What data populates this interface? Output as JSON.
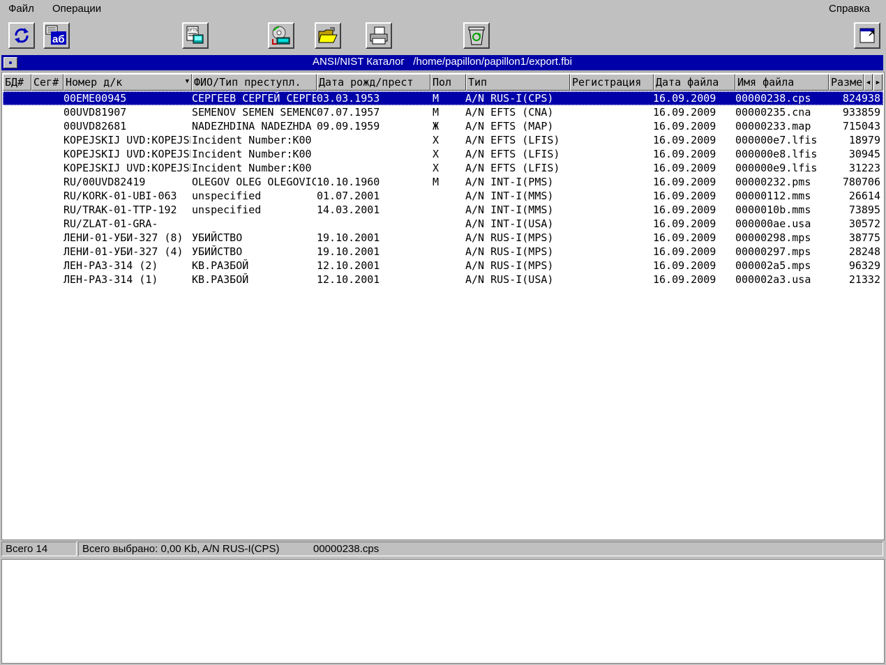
{
  "menu": {
    "file": "Файл",
    "operations": "Операции",
    "help": "Справка"
  },
  "toolbar": {
    "buttons": [
      "refresh-icon",
      "font-icon",
      "efts-icon",
      "cd-icon",
      "open-folder-icon",
      "print-icon",
      "recycle-icon",
      "exit-icon"
    ]
  },
  "window": {
    "title": "ANSI/NIST Каталог   /home/papillon/papillon1/export.fbi"
  },
  "columns": [
    "БД#",
    "Сег#",
    "Номер д/к",
    "ФИО/Тип преступл.",
    "Дата рожд/прест",
    "Пол",
    "Тип",
    "Регистрация",
    "Дата файла",
    "Имя файла",
    "Размер"
  ],
  "rows": [
    {
      "num": "00EME00945",
      "fio": "СЕРГЕЕВ СЕРГЕЙ СЕРГЕЕВИЧ",
      "date": "03.03.1953",
      "sex": "М",
      "type": "A/N RUS-I(CPS)",
      "reg": "",
      "fdate": "16.09.2009",
      "fname": "00000238.cps",
      "size": "824938"
    },
    {
      "num": "00UVD81907",
      "fio": "SEMENOV SEMEN SEMENOVICH",
      "date": "07.07.1957",
      "sex": "М",
      "type": "A/N EFTS (CNA)",
      "reg": "",
      "fdate": "16.09.2009",
      "fname": "00000235.cna",
      "size": "933859"
    },
    {
      "num": "00UVD82681",
      "fio": "NADEZHDINA NADEZHDA",
      "date": "09.09.1959",
      "sex": "Ж",
      "type": "A/N EFTS (MAP)",
      "reg": "",
      "fdate": "16.09.2009",
      "fname": "00000233.map",
      "size": "715043"
    },
    {
      "num": "KOPEJSKIJ UVD:KOPEJSK",
      "fio": "Incident Number:K00",
      "date": "",
      "sex": "X",
      "type": "A/N EFTS (LFIS)",
      "reg": "",
      "fdate": "16.09.2009",
      "fname": "000000e7.lfis",
      "size": "18979"
    },
    {
      "num": "KOPEJSKIJ UVD:KOPEJSK",
      "fio": "Incident Number:K00",
      "date": "",
      "sex": "X",
      "type": "A/N EFTS (LFIS)",
      "reg": "",
      "fdate": "16.09.2009",
      "fname": "000000e8.lfis",
      "size": "30945"
    },
    {
      "num": "KOPEJSKIJ UVD:KOPEJSK",
      "fio": "Incident Number:K00",
      "date": "",
      "sex": "X",
      "type": "A/N EFTS (LFIS)",
      "reg": "",
      "fdate": "16.09.2009",
      "fname": "000000e9.lfis",
      "size": "31223"
    },
    {
      "num": "RU/00UVD82419",
      "fio": "OLEGOV OLEG OLEGOVICH",
      "date": "10.10.1960",
      "sex": "М",
      "type": "A/N INT-I(PMS)",
      "reg": "",
      "fdate": "16.09.2009",
      "fname": "00000232.pms",
      "size": "780706"
    },
    {
      "num": "RU/KORK-01-UBI-063",
      "fio": "unspecified",
      "date": "01.07.2001",
      "sex": "",
      "type": "A/N INT-I(MMS)",
      "reg": "",
      "fdate": "16.09.2009",
      "fname": "00000112.mms",
      "size": "26614"
    },
    {
      "num": "RU/TRAK-01-TTP-192",
      "fio": "unspecified",
      "date": "14.03.2001",
      "sex": "",
      "type": "A/N INT-I(MMS)",
      "reg": "",
      "fdate": "16.09.2009",
      "fname": "0000010b.mms",
      "size": "73895"
    },
    {
      "num": "RU/ZLAT-01-GRA-",
      "fio": "",
      "date": "",
      "sex": "",
      "type": "A/N INT-I(USA)",
      "reg": "",
      "fdate": "16.09.2009",
      "fname": "000000ae.usa",
      "size": "30572"
    },
    {
      "num": "ЛЕНИ-01-УБИ-327 (8)",
      "fio": "УБИЙСТВО",
      "date": "19.10.2001",
      "sex": "",
      "type": "A/N RUS-I(MPS)",
      "reg": "",
      "fdate": "16.09.2009",
      "fname": "00000298.mps",
      "size": "38775"
    },
    {
      "num": "ЛЕНИ-01-УБИ-327 (4)",
      "fio": "УБИЙСТВО",
      "date": "19.10.2001",
      "sex": "",
      "type": "A/N RUS-I(MPS)",
      "reg": "",
      "fdate": "16.09.2009",
      "fname": "00000297.mps",
      "size": "28248"
    },
    {
      "num": "ЛЕН-РАЗ-314 (2)",
      "fio": "КВ.РАЗБОЙ",
      "date": "12.10.2001",
      "sex": "",
      "type": "A/N RUS-I(MPS)",
      "reg": "",
      "fdate": "16.09.2009",
      "fname": "000002a5.mps",
      "size": "96329"
    },
    {
      "num": "ЛЕН-РАЗ-314 (1)",
      "fio": "КВ.РАЗБОЙ",
      "date": "12.10.2001",
      "sex": "",
      "type": "A/N RUS-I(USA)",
      "reg": "",
      "fdate": "16.09.2009",
      "fname": "000002a3.usa",
      "size": "21332"
    }
  ],
  "selected_row": 0,
  "status": {
    "total": "Всего 14",
    "selected": "Всего выбрано: 0,00 Kb, A/N RUS-I(CPS)",
    "filename": "00000238.cps"
  },
  "colors": {
    "selection": "#0000a8",
    "title_bar": "#0000a8",
    "face": "#c0c0c0"
  }
}
